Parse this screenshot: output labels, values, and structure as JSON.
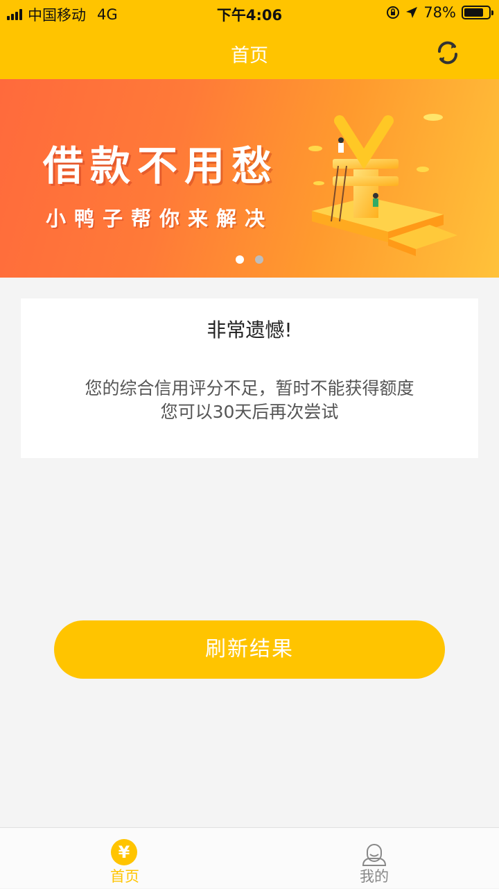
{
  "status_bar": {
    "carrier": "中国移动",
    "network": "4G",
    "time": "下午4:06",
    "battery_percent": "78%",
    "battery_level": 0.78
  },
  "nav": {
    "title": "首页",
    "refresh_icon": "refresh-icon"
  },
  "banner": {
    "headline": "借款不用愁",
    "subline": "小鸭子帮你来解决",
    "pages": 2,
    "active_page": 1
  },
  "result_card": {
    "title": "非常遗憾!",
    "message_line1": "您的综合信用评分不足，暂时不能获得额度",
    "message_line2": "您可以30天后再次尝试"
  },
  "refresh_button": {
    "label": "刷新结果"
  },
  "tab_bar": {
    "tabs": [
      {
        "label": "首页",
        "icon": "yen-icon",
        "active": true
      },
      {
        "label": "我的",
        "icon": "user-icon",
        "active": false
      }
    ]
  },
  "colors": {
    "accent": "#ffc400",
    "tab_active": "#ffc400",
    "tab_inactive": "#888888",
    "dot_active": "#ffffff",
    "dot_inactive": "#bdbdbd"
  }
}
